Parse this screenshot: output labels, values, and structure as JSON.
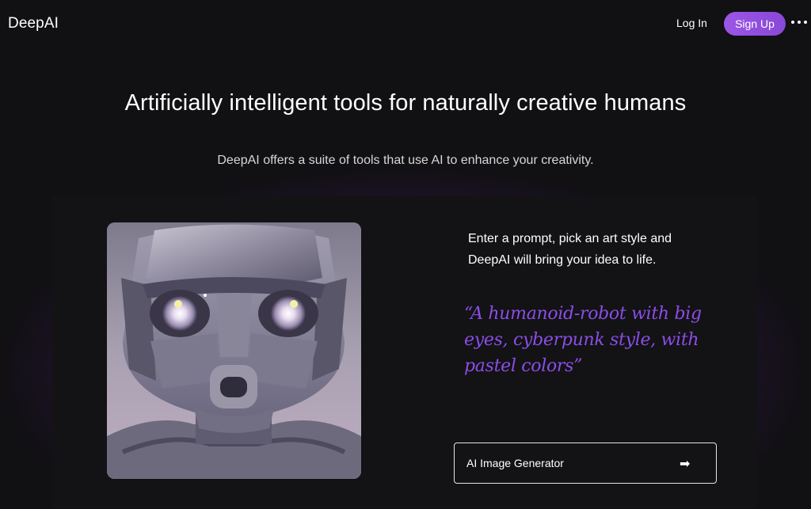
{
  "header": {
    "logo": "DeepAI",
    "login_label": "Log In",
    "signup_label": "Sign Up",
    "more_icon": "more-horizontal-icon"
  },
  "hero": {
    "headline": "Artificially intelligent tools for naturally creative humans",
    "subline": "DeepAI offers a suite of tools that use AI to enhance your creativity."
  },
  "feature": {
    "description": "Enter a prompt, pick an art style and DeepAI will bring your idea to life.",
    "prompt_example": "“A humanoid-robot with big eyes, cyberpunk style, with pastel colors”",
    "cta_label": "AI Image Generator",
    "cta_icon": "arrow-right-icon",
    "cta_arrow": "➡"
  },
  "colors": {
    "accent": "#9b56e6",
    "quote": "#8a4ee6",
    "background": "#111013"
  }
}
